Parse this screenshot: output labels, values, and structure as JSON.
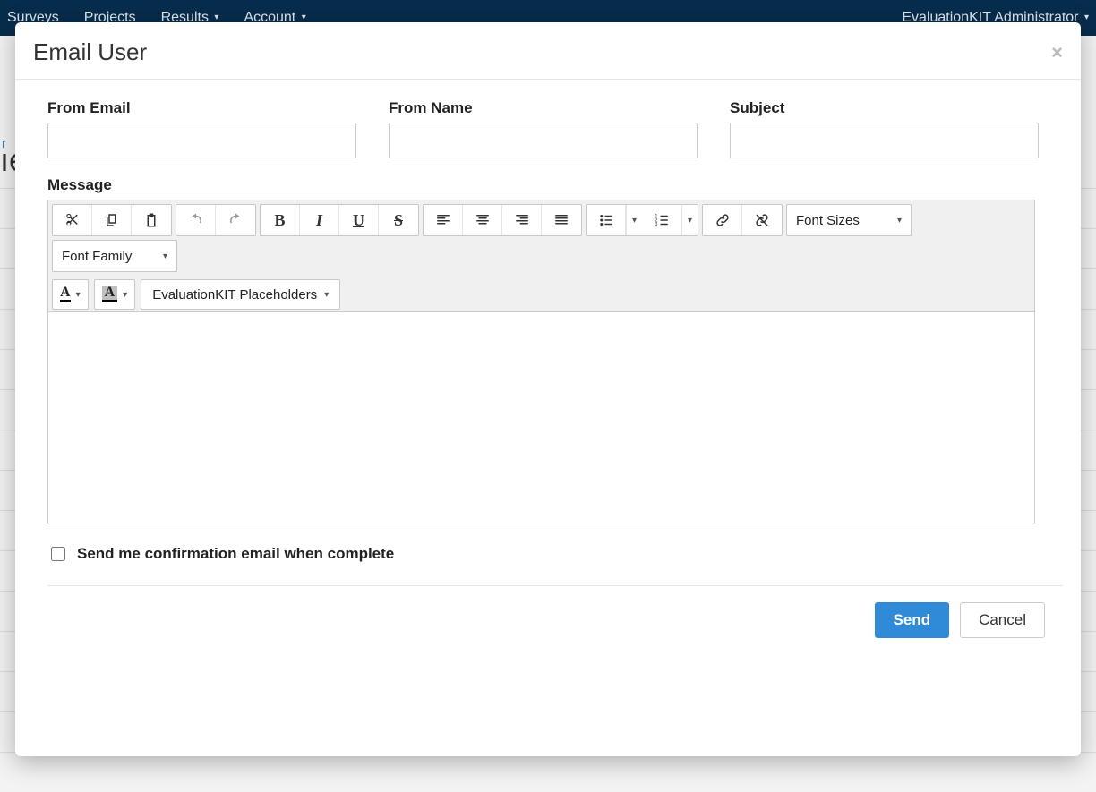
{
  "nav": {
    "items": [
      "Surveys",
      "Projects",
      "Results",
      "Account"
    ],
    "right_label": "EvaluationKIT Administrator"
  },
  "modal": {
    "title": "Email User",
    "labels": {
      "from_email": "From Email",
      "from_name": "From Name",
      "subject": "Subject",
      "message": "Message"
    },
    "values": {
      "from_email": "",
      "from_name": "",
      "subject": "",
      "message": ""
    },
    "toolbar": {
      "font_sizes": "Font Sizes",
      "font_family": "Font Family",
      "placeholders": "EvaluationKIT Placeholders"
    },
    "confirm_label": "Send me confirmation email when complete",
    "confirm_checked": false,
    "actions": {
      "send": "Send",
      "cancel": "Cancel"
    }
  }
}
